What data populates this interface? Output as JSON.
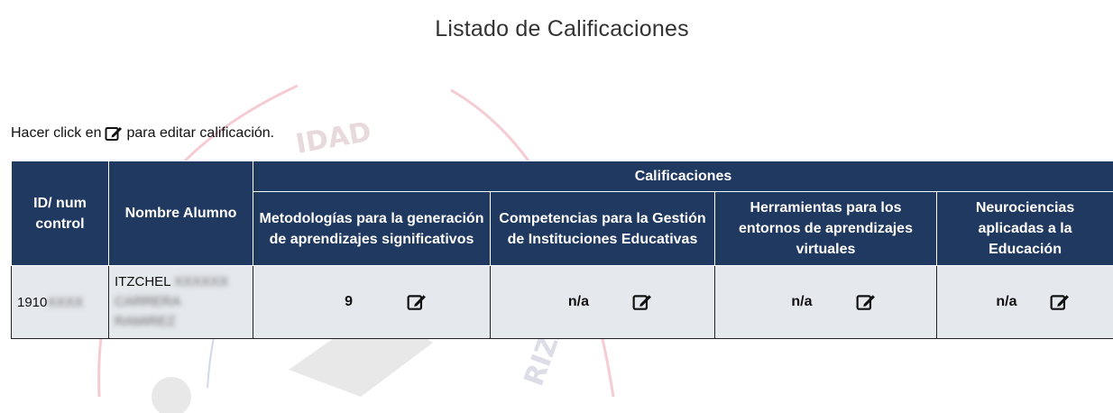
{
  "page": {
    "title": "Listado de Calificaciones",
    "hint_before": "Hacer click en",
    "hint_after": "para editar calificación."
  },
  "table": {
    "headers": {
      "id": "ID/ num control",
      "name": "Nombre Alumno",
      "group": "Calificaciones",
      "subjects": [
        "Metodologías para la generación de aprendizajes significativos",
        "Competencias para la Gestión de Instituciones Educativas",
        "Herramientas para los entornos de aprendizajes virtuales",
        "Neurociencias aplicadas a la Educación"
      ]
    },
    "rows": [
      {
        "id_visible": "1910",
        "id_blurred": "XXXX",
        "name_visible": "ITZCHEL",
        "name_blurred_1": "XXXXXX",
        "name_blurred_2": "CARRERA",
        "name_blurred_3": "RAMIREZ",
        "grades": [
          "9",
          "n/a",
          "n/a",
          "n/a"
        ]
      }
    ]
  },
  "icons": {
    "edit": "edit-icon"
  },
  "colors": {
    "header_bg": "#203960",
    "row_bg": "#e5e8ec"
  }
}
